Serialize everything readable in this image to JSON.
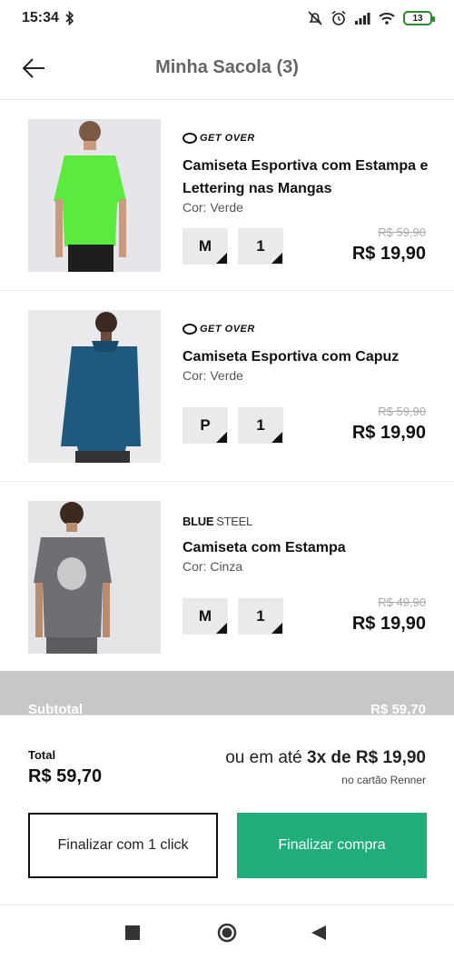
{
  "status_bar": {
    "time": "15:34",
    "battery": "13"
  },
  "header": {
    "title": "Minha Sacola (3)"
  },
  "items": [
    {
      "brand": "GET OVER",
      "name": "Camiseta Esportiva com Estampa e Lettering nas Mangas",
      "color": "Cor: Verde",
      "size": "M",
      "quantity": "1",
      "old_price": "R$ 59,90",
      "price": "R$ 19,90"
    },
    {
      "brand": "GET OVER",
      "name": "Camiseta Esportiva com Capuz",
      "color": "Cor: Verde",
      "size": "P",
      "quantity": "1",
      "old_price": "R$ 59,90",
      "price": "R$ 19,90"
    },
    {
      "brand_bold": "BLUE",
      "brand_light": "STEEL",
      "name": "Camiseta com Estampa",
      "color": "Cor: Cinza",
      "size": "M",
      "quantity": "1",
      "old_price": "R$ 49,90",
      "price": "R$ 19,90"
    }
  ],
  "subtotal": {
    "label": "Subtotal",
    "value": "R$ 59,70"
  },
  "summary": {
    "total_label": "Total",
    "total_value": "R$ 59,70",
    "installment_prefix": "ou em até",
    "installment_value": "3x de R$ 19,90",
    "installment_note": "no cartão Renner"
  },
  "buttons": {
    "one_click": "Finalizar com 1 click",
    "checkout": "Finalizar compra"
  },
  "colors": {
    "accent": "#1fae7a",
    "strip": "#c7c7c7"
  }
}
